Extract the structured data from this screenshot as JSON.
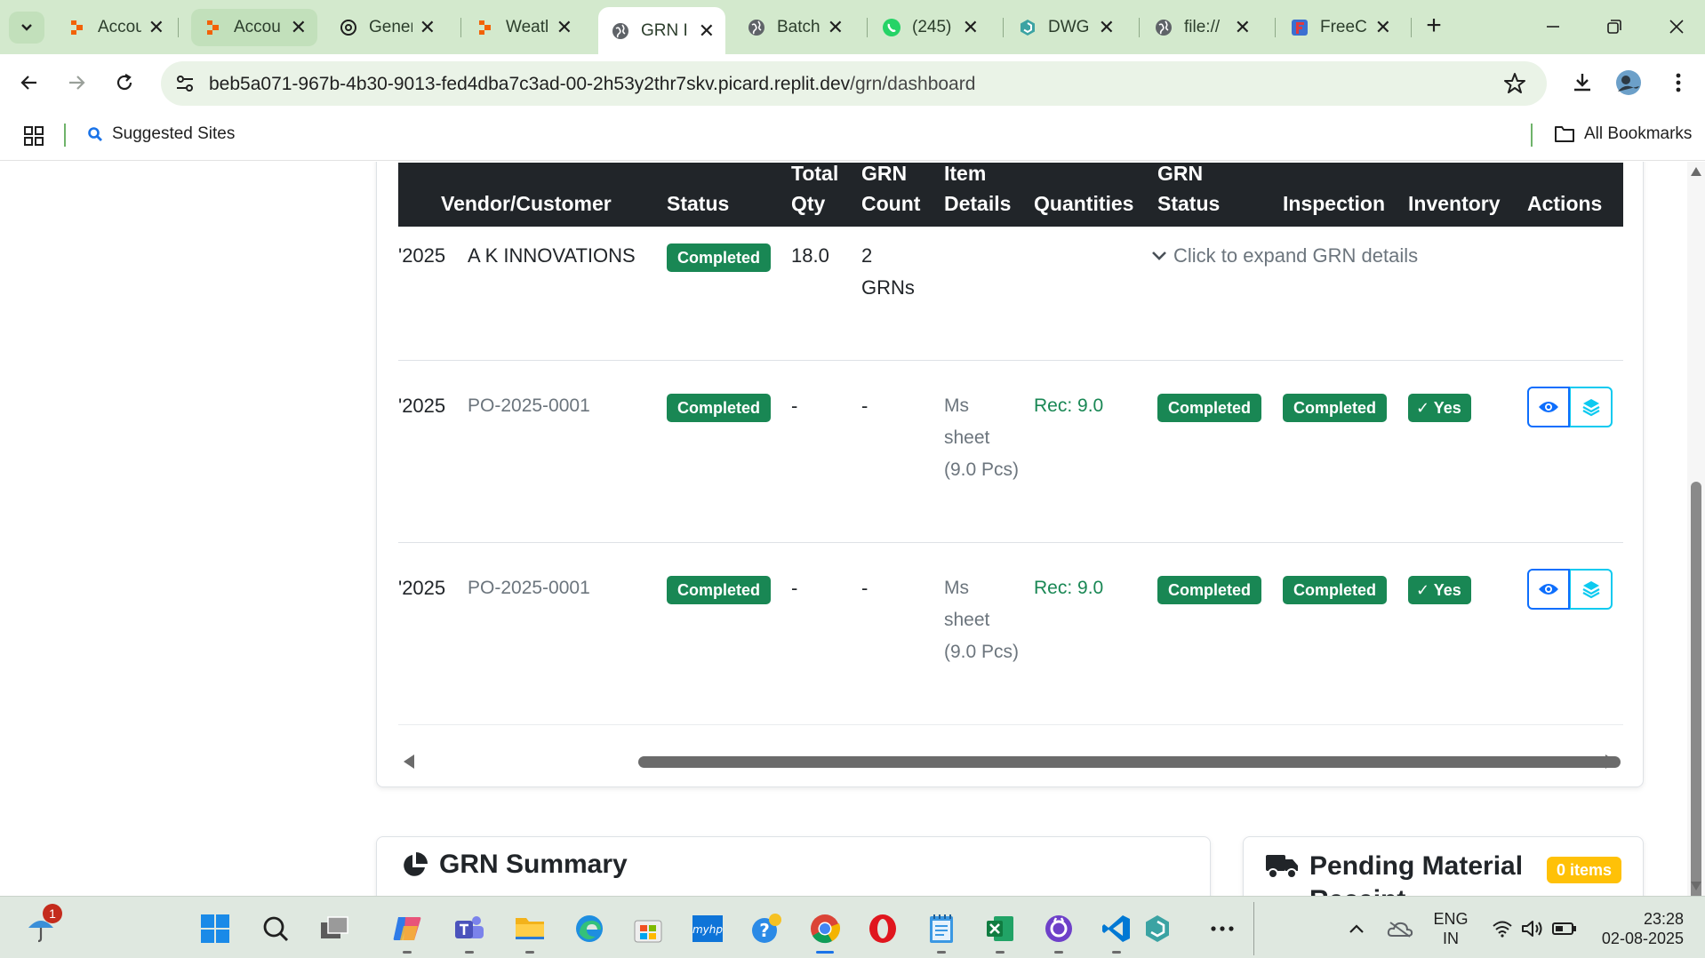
{
  "browser": {
    "tabs": [
      {
        "label": "Accou",
        "icon": "replit-icon"
      },
      {
        "label": "Accou",
        "icon": "replit-icon"
      },
      {
        "label": "Gener",
        "icon": "chatgpt-icon"
      },
      {
        "label": "Weatl",
        "icon": "replit-icon"
      },
      {
        "label": "GRN I",
        "icon": "globe-icon"
      },
      {
        "label": "Batch",
        "icon": "globe-icon"
      },
      {
        "label": "(245)",
        "icon": "whatsapp-icon"
      },
      {
        "label": "DWG",
        "icon": "dwg-icon"
      },
      {
        "label": "file://",
        "icon": "globe-icon"
      },
      {
        "label": "FreeC",
        "icon": "freecodecamp-icon"
      }
    ],
    "url_host": "beb5a071-967b-4b30-9013-fed4dba7c3ad-00-2h53y2thr7skv.picard.replit.dev",
    "url_path": "/grn/dashboard",
    "bookmarks": {
      "suggested": "Suggested Sites",
      "all": "All Bookmarks"
    }
  },
  "table": {
    "headers": {
      "vendor": "Vendor/Customer",
      "status": "Status",
      "total_qty_1": "Total",
      "total_qty_2": "Qty",
      "grn_count_1": "GRN",
      "grn_count_2": "Count",
      "item_details_1": "Item",
      "item_details_2": "Details",
      "quantities": "Quantities",
      "grn_status_1": "GRN",
      "grn_status_2": "Status",
      "inspection": "Inspection",
      "inventory": "Inventory",
      "actions": "Actions"
    },
    "group_row": {
      "date": "'2025",
      "vendor": "A K INNOVATIONS",
      "status": "Completed",
      "total_qty": "18.0",
      "grn_count_1": "2",
      "grn_count_2": "GRNs",
      "expand_text": "Click to expand GRN details"
    },
    "rows": [
      {
        "date": "'2025",
        "vendor": "PO-2025-0001",
        "status": "Completed",
        "total_qty": "-",
        "grn_count": "-",
        "item_1": "Ms",
        "item_2": "sheet",
        "item_3": "(9.0 Pcs)",
        "quantities": "Rec: 9.0",
        "grn_status": "Completed",
        "inspection": "Completed",
        "inventory": "Yes"
      },
      {
        "date": "'2025",
        "vendor": "PO-2025-0001",
        "status": "Completed",
        "total_qty": "-",
        "grn_count": "-",
        "item_1": "Ms",
        "item_2": "sheet",
        "item_3": "(9.0 Pcs)",
        "quantities": "Rec: 9.0",
        "grn_status": "Completed",
        "inspection": "Completed",
        "inventory": "Yes"
      }
    ]
  },
  "summary_card": {
    "title": "GRN Summary"
  },
  "pending_card": {
    "title": "Pending Material Receipt",
    "badge": "0 items"
  },
  "taskbar": {
    "notification_count": "1",
    "lang_1": "ENG",
    "lang_2": "IN",
    "time": "23:28",
    "date": "02-08-2025"
  },
  "colors": {
    "success": "#198754",
    "primary": "#0d6efd",
    "warning": "#ffc107",
    "table_head": "#212529",
    "tabstrip": "#d3e9cd"
  }
}
